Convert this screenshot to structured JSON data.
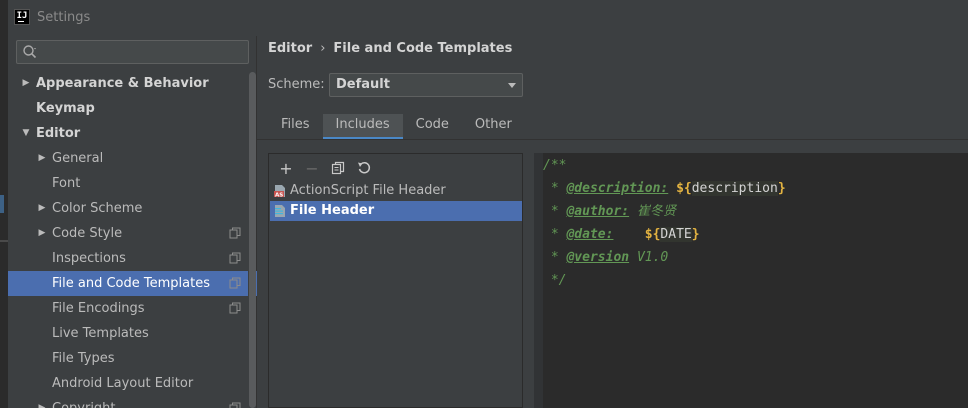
{
  "window": {
    "title": "Settings",
    "app_icon_text": "IJ"
  },
  "search": {
    "value": "",
    "placeholder": ""
  },
  "tree": [
    {
      "label": "Appearance & Behavior",
      "level": 0,
      "arrow": "collapsed",
      "bold": true
    },
    {
      "label": "Keymap",
      "level": 0,
      "arrow": "none",
      "bold": true
    },
    {
      "label": "Editor",
      "level": 0,
      "arrow": "expanded",
      "bold": true
    },
    {
      "label": "General",
      "level": 1,
      "arrow": "collapsed"
    },
    {
      "label": "Font",
      "level": 1,
      "arrow": "none"
    },
    {
      "label": "Color Scheme",
      "level": 1,
      "arrow": "collapsed"
    },
    {
      "label": "Code Style",
      "level": 1,
      "arrow": "collapsed",
      "copy_icon": true
    },
    {
      "label": "Inspections",
      "level": 1,
      "arrow": "none",
      "copy_icon": true
    },
    {
      "label": "File and Code Templates",
      "level": 1,
      "arrow": "none",
      "copy_icon": true,
      "selected": true
    },
    {
      "label": "File Encodings",
      "level": 1,
      "arrow": "none",
      "copy_icon": true
    },
    {
      "label": "Live Templates",
      "level": 1,
      "arrow": "none"
    },
    {
      "label": "File Types",
      "level": 1,
      "arrow": "none"
    },
    {
      "label": "Android Layout Editor",
      "level": 1,
      "arrow": "none"
    },
    {
      "label": "Copyright",
      "level": 1,
      "arrow": "collapsed",
      "copy_icon": true
    }
  ],
  "breadcrumb": {
    "parent": "Editor",
    "separator": "›",
    "current": "File and Code Templates"
  },
  "scheme": {
    "label": "Scheme:",
    "value": "Default"
  },
  "tabs": [
    {
      "label": "Files",
      "active": false
    },
    {
      "label": "Includes",
      "active": true
    },
    {
      "label": "Code",
      "active": false
    },
    {
      "label": "Other",
      "active": false
    }
  ],
  "toolbar": {
    "add_label": "+",
    "remove_label": "−"
  },
  "templates": [
    {
      "label": "ActionScript File Header",
      "icon": "actionscript-file-icon",
      "selected": false
    },
    {
      "label": "File Header",
      "icon": "file-header-icon",
      "selected": true
    }
  ],
  "editor": {
    "lines": [
      {
        "text": "/**"
      },
      {
        "prefix": " * ",
        "tag": "@description:",
        "gap": " ",
        "var": "description"
      },
      {
        "prefix": " * ",
        "tag": "@author:",
        "gap": " ",
        "value": "崔冬贤"
      },
      {
        "prefix": " * ",
        "tag": "@date:",
        "gap": "    ",
        "var": "DATE"
      },
      {
        "prefix": " * ",
        "tag": "@version",
        "gap": " ",
        "value": "V1.0"
      },
      {
        "text": " */"
      }
    ]
  },
  "colors": {
    "selection": "#4b6eaf",
    "comment": "#629755",
    "template_var": "#e3b341"
  }
}
